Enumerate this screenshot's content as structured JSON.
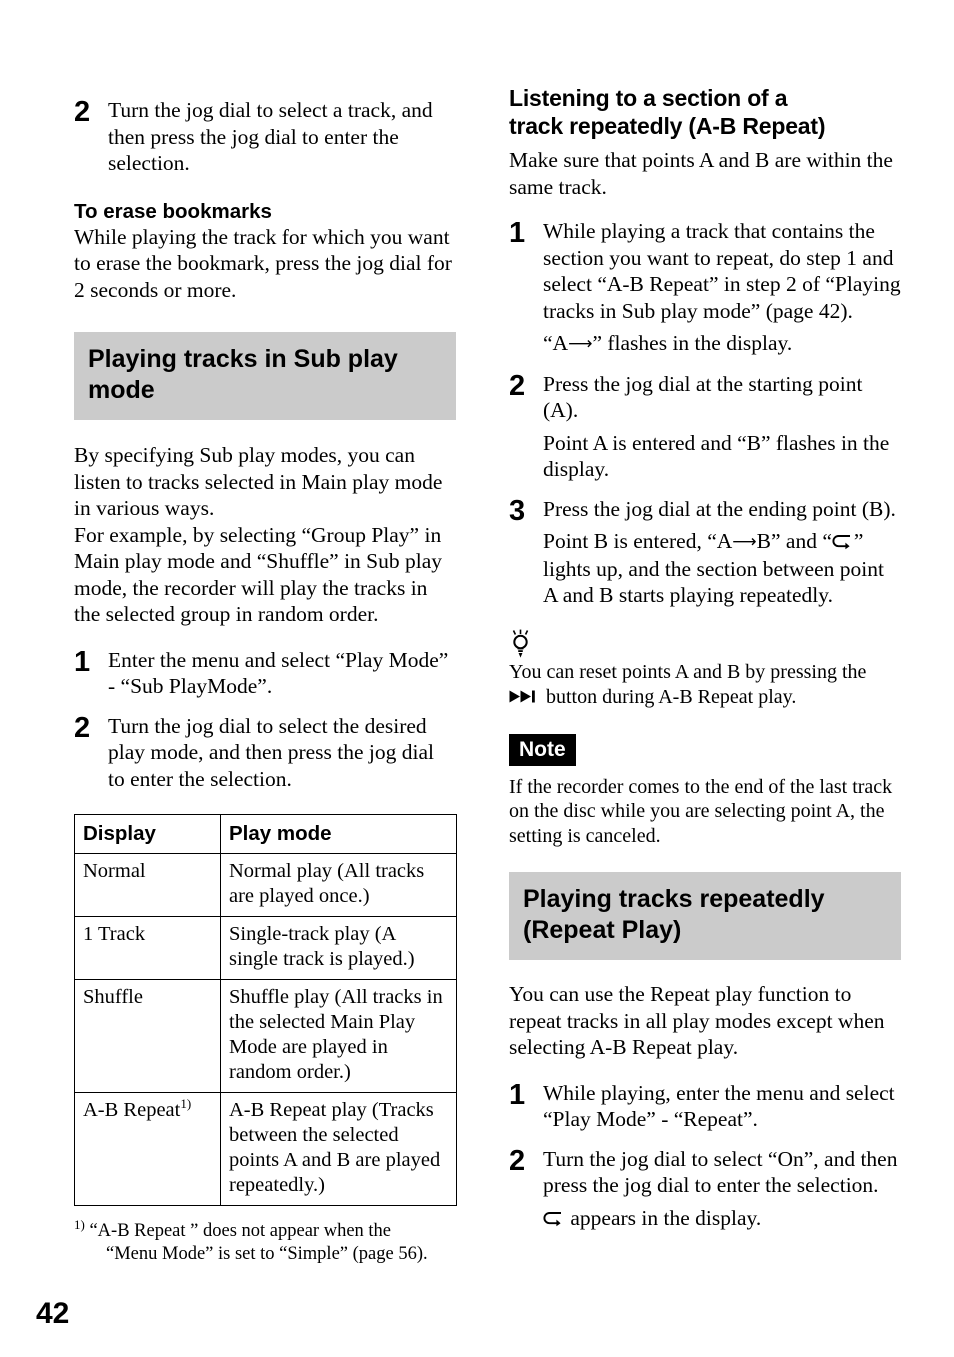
{
  "page": {
    "number": "42",
    "accent_gray": "#cbcbcb",
    "text_color": "#000000"
  },
  "left_column": {
    "step_2_top": {
      "number": "2",
      "text": "Turn the jog dial to select a track, and then press the jog dial to enter the selection."
    },
    "erase_bookmarks": {
      "heading": "To erase bookmarks",
      "text": "While playing the track for which you want to erase the bookmark, press the jog dial for 2 seconds or more."
    },
    "section_heading": "Playing tracks in Sub play mode",
    "intro_paragraph_1": "By specifying Sub play modes, you can listen to tracks selected in Main play mode in various ways.",
    "intro_paragraph_2": "For example, by selecting “Group Play” in Main play mode and “Shuffle” in Sub play mode, the recorder will play the tracks in the selected group in random order.",
    "steps": [
      {
        "number": "1",
        "text": "Enter the menu and select “Play Mode” - “Sub PlayMode”."
      },
      {
        "number": "2",
        "text": "Turn the jog dial to select the desired play mode, and then press the jog dial to enter the selection."
      }
    ],
    "table": {
      "headers": [
        "Display",
        "Play mode"
      ],
      "rows": [
        {
          "display": "Normal",
          "display_footnote": "",
          "play_mode": "Normal play (All tracks are played once.)"
        },
        {
          "display": "1 Track",
          "display_footnote": "",
          "play_mode": "Single-track play (A single track is played.)"
        },
        {
          "display": "Shuffle",
          "display_footnote": "",
          "play_mode": "Shuffle play (All tracks in the selected Main Play Mode are played in random order.)"
        },
        {
          "display": "A-B Repeat",
          "display_footnote": "1)",
          "play_mode": "A-B Repeat play (Tracks between the selected points A and B are played repeatedly.)"
        }
      ]
    },
    "footnote": {
      "mark": "1)",
      "line1": "“A-B Repeat ” does not appear when the",
      "line2": "“Menu Mode” is set to “Simple” (page 56)."
    }
  },
  "right_column": {
    "ab_repeat": {
      "heading_line1": "Listening to a section of a",
      "heading_line2": "track repeatedly (A-B Repeat)",
      "intro": "Make sure that points A and B are within the same track.",
      "steps": [
        {
          "number": "1",
          "text": "While playing a track that contains the section you want to repeat, do step 1 and select “A-B Repeat” in step 2 of “Playing tracks in Sub play mode” (page 42).",
          "result_prefix": "“A",
          "result_suffix": "” flashes in the display."
        },
        {
          "number": "2",
          "text": "Press the jog dial at the starting point (A).",
          "result": "Point A is entered and “B” flashes in the display."
        },
        {
          "number": "3",
          "text": "Press the jog dial at the ending point (B).",
          "result_part1": "Point B is entered, “A",
          "result_part2": "B” and “",
          "result_part3": "” lights up, and the section between point A and B starts playing repeatedly."
        }
      ]
    },
    "tip": {
      "icon": "lightbulb-icon",
      "text_part1": "You can reset points A and B by pressing the",
      "text_part2": "button during A-B Repeat play."
    },
    "note": {
      "badge_label": "Note",
      "text": "If the recorder comes to the end of the last track on the disc while you are selecting point A, the setting is canceled."
    },
    "repeat_play": {
      "section_heading_line1": "Playing tracks repeatedly",
      "section_heading_line2": "(Repeat Play)",
      "intro": "You can use the Repeat play function to repeat tracks in all play modes except when selecting A-B Repeat play.",
      "steps": [
        {
          "number": "1",
          "text": "While playing, enter the menu and select “Play Mode” - “Repeat”."
        },
        {
          "number": "2",
          "text": "Turn the jog dial to select “On”, and then press the jog dial to enter the selection.",
          "result_suffix": "appears in the display."
        }
      ]
    }
  },
  "icons": {
    "lightbulb": "lightbulb-icon",
    "repeat_loop": "repeat-loop-icon",
    "fast_forward": "fast-forward-icon",
    "right_arrow": "right-arrow-icon"
  }
}
